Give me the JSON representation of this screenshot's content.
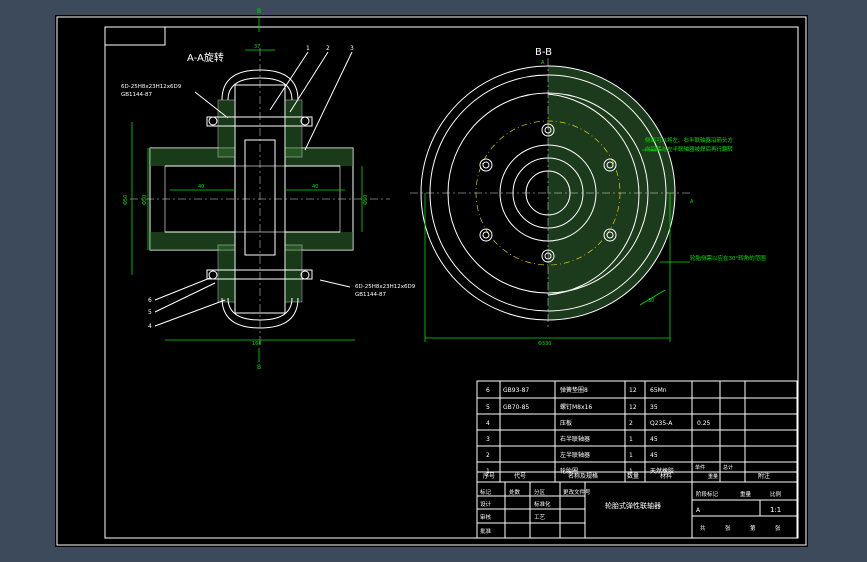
{
  "colors": {
    "background": "#3c4a5c",
    "sheet": "#000000",
    "line": "#ffffff",
    "dimension": "#00e000",
    "center": "#e0d000"
  },
  "views": {
    "left_title": "A-A旋转",
    "right_title": "B-B",
    "cut_a": "A",
    "cut_b": "B"
  },
  "left_labels": {
    "thread_top_1": "6D-25H8x23H12x6D9",
    "thread_top_2": "GB1144-87",
    "thread_bot_1": "6D-25H8x23H12x6D9",
    "thread_bot_2": "GB1144-87",
    "dim_top": "37",
    "dim_40a": "40",
    "dim_40b": "40",
    "dim_phi1": "Φ50",
    "dim_phi2": "Φ50",
    "dim_phi3": "Φ50",
    "dim_width": "166",
    "bal_1": "1",
    "bal_2": "2",
    "bal_3": "3",
    "bal_4": "4",
    "bal_5": "5",
    "bal_6": "6"
  },
  "right_labels": {
    "note_1": "侧面可以将左、右半联轴器沿箭头方",
    "note_2": "向回转与左半联轴器被焊后再行翻转",
    "note_3": "轮胎侧需以应在30°转角的范围",
    "dim_dia": "Φ330",
    "dim_angle": "30"
  },
  "bom": {
    "rows": [
      {
        "no": "6",
        "code": "GB93-87",
        "name": "弹簧垫圈8",
        "qty": "12",
        "mat": "65Mn",
        "wt": ""
      },
      {
        "no": "5",
        "code": "GB70-85",
        "name": "螺钉M8x16",
        "qty": "12",
        "mat": "35",
        "wt": ""
      },
      {
        "no": "4",
        "code": "",
        "name": "压板",
        "qty": "2",
        "mat": "Q235-A",
        "wt": "0.25"
      },
      {
        "no": "3",
        "code": "",
        "name": "右半联轴器",
        "qty": "1",
        "mat": "45",
        "wt": ""
      },
      {
        "no": "2",
        "code": "",
        "name": "左半联轴器",
        "qty": "1",
        "mat": "45",
        "wt": ""
      },
      {
        "no": "1",
        "code": "",
        "name": "轮胎圈",
        "qty": "1",
        "mat": "天然橡胶",
        "wt": ""
      }
    ],
    "header": {
      "no": "序号",
      "code": "代号",
      "name": "名称及规格",
      "qty": "数量",
      "mat": "材料",
      "wt1": "单件",
      "wt2": "总计",
      "wt3": "重量",
      "note": "附注"
    }
  },
  "title_block": {
    "drawing_title": "轮胎式弹性联轴器",
    "labels": [
      "标记",
      "处数",
      "分区",
      "更改文件号",
      "签名",
      "年月日",
      "设计",
      "标准化",
      "审核",
      "工艺",
      "批准",
      "阶段标记",
      "重量",
      "比例",
      "共",
      "张",
      "第",
      "张"
    ],
    "scale": "1:1",
    "stage": "A"
  }
}
